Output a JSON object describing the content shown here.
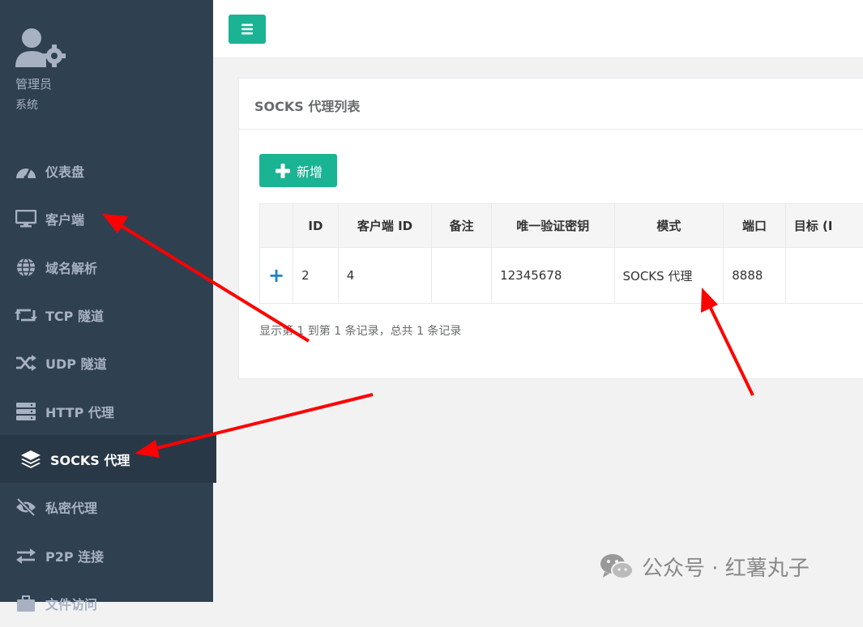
{
  "sidebar": {
    "profile": {
      "name": "管理员",
      "role": "系统"
    },
    "items": [
      {
        "label": "仪表盘",
        "icon": "dashboard-icon"
      },
      {
        "label": "客户端",
        "icon": "monitor-icon"
      },
      {
        "label": "域名解析",
        "icon": "globe-icon"
      },
      {
        "label": "TCP 隧道",
        "icon": "retweet-icon"
      },
      {
        "label": "UDP 隧道",
        "icon": "shuffle-icon"
      },
      {
        "label": "HTTP 代理",
        "icon": "server-icon"
      },
      {
        "label": "SOCKS 代理",
        "icon": "layers-icon",
        "active": true
      },
      {
        "label": "私密代理",
        "icon": "eye-slash-icon"
      },
      {
        "label": "P2P 连接",
        "icon": "exchange-icon"
      },
      {
        "label": "文件访问",
        "icon": "briefcase-icon"
      }
    ]
  },
  "panel": {
    "title": "SOCKS 代理列表",
    "add_label": "新增",
    "table": {
      "headers": [
        "",
        "ID",
        "客户端 ID",
        "备注",
        "唯一验证密钥",
        "模式",
        "端口",
        "目标 (I"
      ],
      "rows": [
        {
          "expand": "+",
          "id": "2",
          "client_id": "4",
          "remark": "",
          "key": "12345678",
          "mode": "SOCKS 代理",
          "port": "8888",
          "target": ""
        }
      ]
    },
    "info": "显示第 1 到第 1 条记录，总共 1 条记录"
  },
  "watermark": {
    "text": "公众号 · 红薯丸子"
  },
  "colors": {
    "sidebar_bg": "#2f4050",
    "accent": "#1ab394",
    "arrow": "#ff0000",
    "expand": "#1c84c6"
  }
}
